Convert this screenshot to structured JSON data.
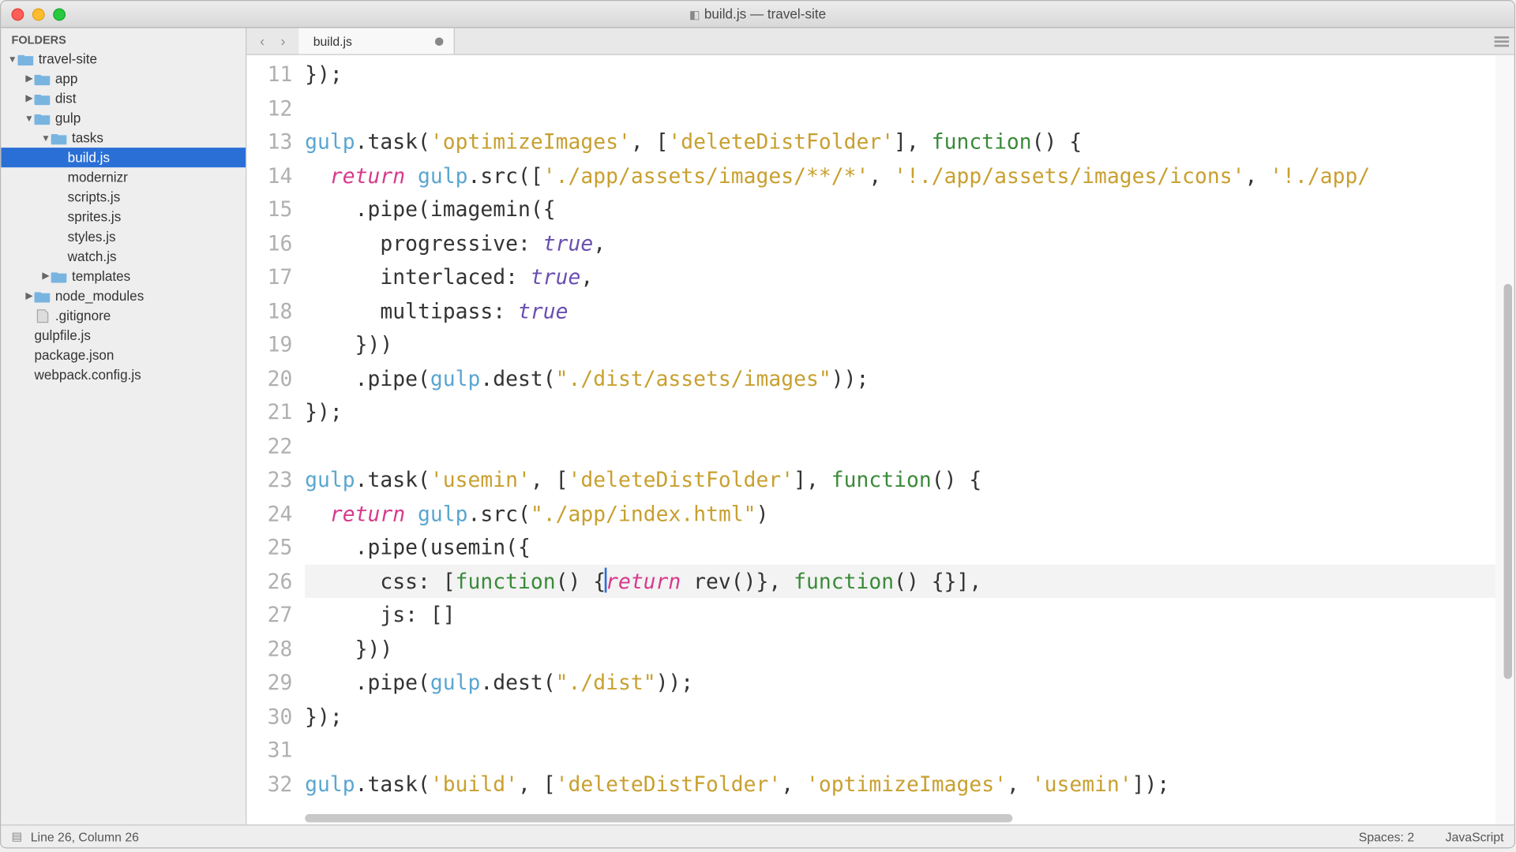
{
  "window": {
    "title": "build.js — travel-site"
  },
  "sidebar": {
    "header": "FOLDERS",
    "tree": {
      "root": "travel-site",
      "app": "app",
      "dist": "dist",
      "gulp": "gulp",
      "tasks": "tasks",
      "build": "build.js",
      "modernizr": "modernizr",
      "scripts": "scripts.js",
      "sprites": "sprites.js",
      "styles": "styles.js",
      "watch": "watch.js",
      "templates": "templates",
      "node_modules": "node_modules",
      "gitignore": ".gitignore",
      "gulpfile": "gulpfile.js",
      "package": "package.json",
      "webpack": "webpack.config.js"
    }
  },
  "tabs": {
    "active": "build.js"
  },
  "code": {
    "lines": {
      "11": "});",
      "12": "",
      "13a": "gulp",
      "13b": ".task(",
      "13c": "'optimizeImages'",
      "13d": ", [",
      "13e": "'deleteDistFolder'",
      "13f": "], ",
      "13g": "function",
      "13h": "() {",
      "14a": "  ",
      "14b": "return",
      "14c": " ",
      "14d": "gulp",
      "14e": ".src([",
      "14f": "'./app/assets/images/**/*'",
      "14g": ", ",
      "14h": "'!./app/assets/images/icons'",
      "14i": ", ",
      "14j": "'!./app/",
      "15a": "    .pipe(imagemin({",
      "16a": "      progressive: ",
      "16b": "true",
      "16c": ",",
      "17a": "      interlaced: ",
      "17b": "true",
      "17c": ",",
      "18a": "      multipass: ",
      "18b": "true",
      "19": "    }))",
      "20a": "    .pipe(",
      "20b": "gulp",
      "20c": ".dest(",
      "20d": "\"./dist/assets/images\"",
      "20e": "));",
      "21": "});",
      "22": "",
      "23a": "gulp",
      "23b": ".task(",
      "23c": "'usemin'",
      "23d": ", [",
      "23e": "'deleteDistFolder'",
      "23f": "], ",
      "23g": "function",
      "23h": "() {",
      "24a": "  ",
      "24b": "return",
      "24c": " ",
      "24d": "gulp",
      "24e": ".src(",
      "24f": "\"./app/index.html\"",
      "24g": ")",
      "25": "    .pipe(usemin({",
      "26a": "      css: [",
      "26b": "function",
      "26c": "() {",
      "26d": "return",
      "26e": " rev()}, ",
      "26f": "function",
      "26g": "() {}],",
      "27": "      js: []",
      "28": "    }))",
      "29a": "    .pipe(",
      "29b": "gulp",
      "29c": ".dest(",
      "29d": "\"./dist\"",
      "29e": "));",
      "30": "});",
      "31": "",
      "32a": "gulp",
      "32b": ".task(",
      "32c": "'build'",
      "32d": ", [",
      "32e": "'deleteDistFolder'",
      "32f": ", ",
      "32g": "'optimizeImages'",
      "32h": ", ",
      "32i": "'usemin'",
      "32j": "]);"
    },
    "line_numbers": [
      "11",
      "12",
      "13",
      "14",
      "15",
      "16",
      "17",
      "18",
      "19",
      "20",
      "21",
      "22",
      "23",
      "24",
      "25",
      "26",
      "27",
      "28",
      "29",
      "30",
      "31",
      "32"
    ]
  },
  "statusbar": {
    "position": "Line 26, Column 26",
    "spaces": "Spaces: 2",
    "syntax": "JavaScript"
  }
}
